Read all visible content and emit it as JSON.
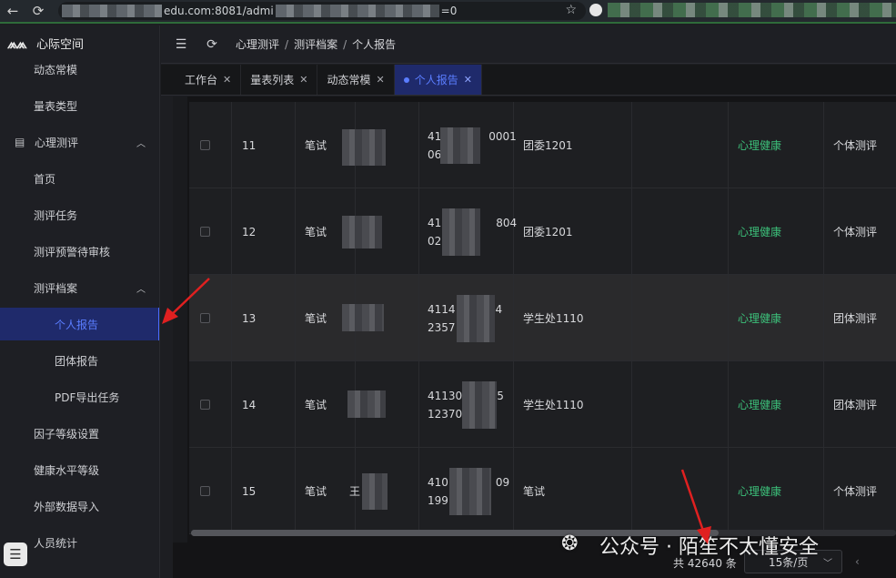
{
  "browser": {
    "url_visible_part1": "edu.com:8081/admi",
    "url_visible_part2": "=0"
  },
  "sidebar": {
    "brand": "心际空间",
    "items": [
      {
        "label": "动态常模"
      },
      {
        "label": "量表类型"
      },
      {
        "label": "心理测评"
      },
      {
        "label": "首页"
      },
      {
        "label": "测评任务"
      },
      {
        "label": "测评预警待审核"
      },
      {
        "label": "测评档案"
      },
      {
        "label": "个人报告"
      },
      {
        "label": "团体报告"
      },
      {
        "label": "PDF导出任务"
      },
      {
        "label": "因子等级设置"
      },
      {
        "label": "健康水平等级"
      },
      {
        "label": "外部数据导入"
      },
      {
        "label": "人员统计"
      }
    ]
  },
  "header": {
    "breadcrumb": [
      "心理测评",
      "测评档案",
      "个人报告"
    ],
    "sep": "/"
  },
  "tabs": [
    {
      "label": "工作台"
    },
    {
      "label": "量表列表"
    },
    {
      "label": "动态常模"
    },
    {
      "label": "个人报告"
    }
  ],
  "table": {
    "rows": [
      {
        "no": "11",
        "type": "笔试",
        "id_line1": "41",
        "id_line1_end": "0001",
        "id_line2": "06",
        "org": "团委1201",
        "category": "心理健康",
        "mode": "个体测评",
        "name": ""
      },
      {
        "no": "12",
        "type": "笔试",
        "id_line1": "41",
        "id_line1_end": "804",
        "id_line2": "02",
        "org": "团委1201",
        "category": "心理健康",
        "mode": "个体测评",
        "name": ""
      },
      {
        "no": "13",
        "type": "笔试",
        "id_line1": "4114",
        "id_line1_end": "4",
        "id_line2": "2357",
        "org": "学生处1110",
        "category": "心理健康",
        "mode": "团体测评",
        "name": ""
      },
      {
        "no": "14",
        "type": "笔试",
        "id_line1": "41130",
        "id_line1_end": "5",
        "id_line2": "12370",
        "org": "学生处1110",
        "category": "心理健康",
        "mode": "团体测评",
        "name": ""
      },
      {
        "no": "15",
        "type": "笔试",
        "id_line1": "410",
        "id_line1_end": "09",
        "id_line2": "199",
        "org": "笔试",
        "category": "心理健康",
        "mode": "个体测评",
        "name": "王"
      }
    ]
  },
  "footer": {
    "total": "共 42640 条",
    "page_size": "15条/页"
  },
  "watermark": {
    "text": "公众号 · 陌笙不太懂安全"
  },
  "colors": {
    "accent": "#5a7dff",
    "active_bg": "#1f2a6b",
    "green": "#3cc07a",
    "annotation": "#e02020"
  },
  "icons": [
    "back-arrow-icon",
    "reload-icon",
    "star-icon",
    "menu-fold-icon",
    "refresh-icon",
    "document-icon",
    "chevron-up-icon",
    "close-icon",
    "chevron-down-icon",
    "chevron-left-icon",
    "chat-icon",
    "wechat-icon"
  ]
}
